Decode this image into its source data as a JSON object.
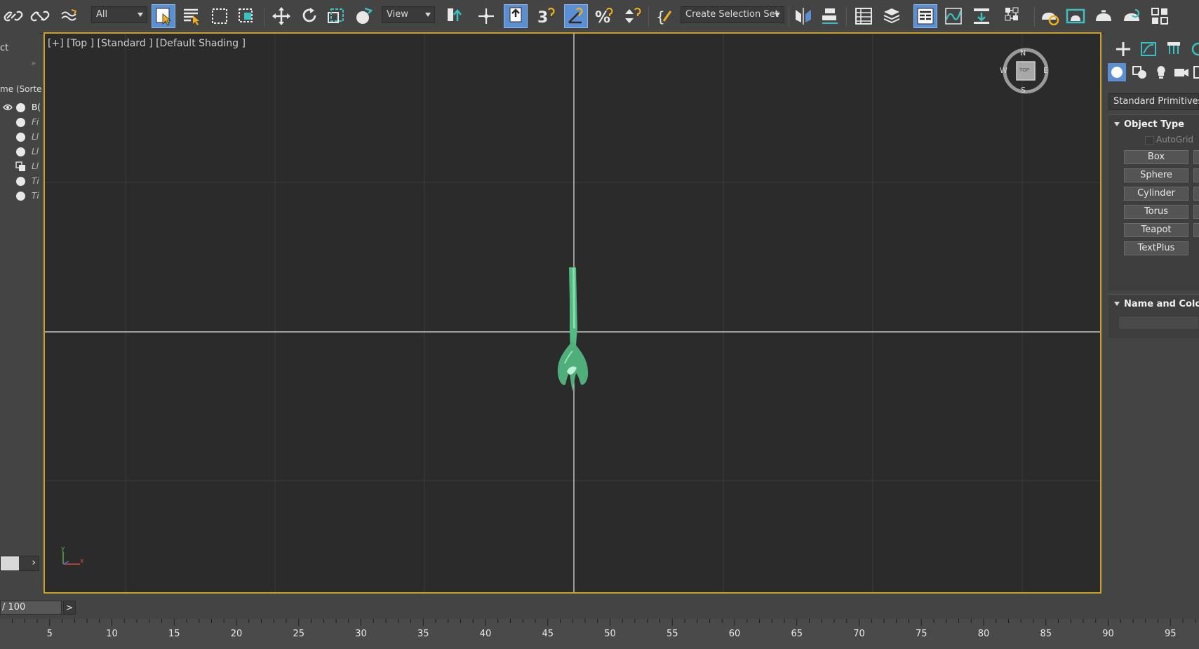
{
  "toolbar": {
    "filter_select": "All",
    "ref_coord_select": "View",
    "selection_set_select": "Create Selection Set",
    "icons": [
      "link-icon",
      "unlink-icon",
      "bind-space-warp-icon",
      "select-object-icon",
      "select-by-name-icon",
      "rectangular-selection-icon",
      "window-crossing-icon",
      "move-icon",
      "rotate-icon",
      "scale-icon",
      "placement-icon",
      "pivot-center-icon",
      "select-manipulate-icon",
      "keyboard-shortcut-icon",
      "snaps-toggle-icon",
      "angle-snap-icon",
      "percent-snap-icon",
      "spinner-snap-icon",
      "edit-named-selection-icon",
      "mirror-icon",
      "align-icon",
      "toggle-scene-explorer-icon",
      "toggle-layer-explorer-icon",
      "toggle-ribbon-icon",
      "curve-editor-icon",
      "schematic-view-icon",
      "material-editor-icon",
      "render-setup-icon",
      "rendered-frame-window-icon",
      "render-production-icon",
      "render-iterative-icon",
      "a360-cloud-icon"
    ]
  },
  "scene_explorer": {
    "header_partial": "ct",
    "column_partial": "me (Sorte",
    "rows": [
      {
        "name": "B(",
        "italic": false
      },
      {
        "name": "Fi",
        "italic": true
      },
      {
        "name": "Ll",
        "italic": true
      },
      {
        "name": "Ll",
        "italic": true
      },
      {
        "name": "Ll",
        "italic": true
      },
      {
        "name": "Ti",
        "italic": true
      },
      {
        "name": "Ti",
        "italic": true
      }
    ]
  },
  "viewport": {
    "label": "[+] [Top ] [Standard ] [Default Shading ]",
    "viewcube_label": "TOP",
    "compass": {
      "n": "N",
      "s": "S",
      "e": "E",
      "w": "W"
    },
    "colors": {
      "background": "#2b2b2b",
      "border": "#c9a227",
      "object": "#4fae7a"
    }
  },
  "command_panel": {
    "category_select": "Standard Primitives",
    "object_type_title": "Object Type",
    "autogrid_label": "AutoGrid",
    "buttons": [
      "Box",
      "Sphere",
      "Cylinder",
      "Torus",
      "Teapot",
      "TextPlus"
    ],
    "name_color_title": "Name and Color"
  },
  "timeline": {
    "slider_label": "/ 100",
    "next_label": ">",
    "ticks": [
      "5",
      "10",
      "15",
      "20",
      "25",
      "30",
      "35",
      "40",
      "45",
      "50",
      "55",
      "60",
      "65",
      "70",
      "75",
      "80",
      "85",
      "90",
      "95"
    ]
  }
}
